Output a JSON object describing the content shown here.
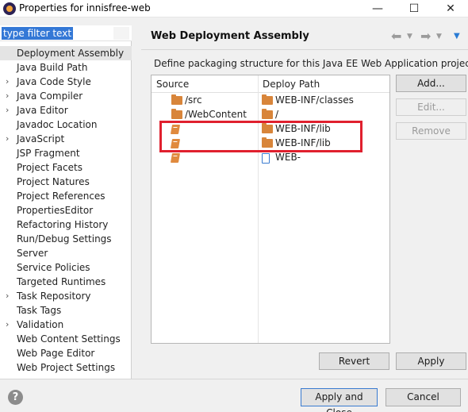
{
  "window": {
    "title": "Properties for innisfree-web",
    "minimize_glyph": "—",
    "maximize_glyph": "☐",
    "close_glyph": "✕"
  },
  "filter": {
    "value": "type filter text"
  },
  "tree": {
    "items": [
      {
        "label": "Deployment Assembly",
        "expandable": false,
        "selected": true
      },
      {
        "label": "Java Build Path",
        "expandable": false
      },
      {
        "label": "Java Code Style",
        "expandable": true
      },
      {
        "label": "Java Compiler",
        "expandable": true
      },
      {
        "label": "Java Editor",
        "expandable": true
      },
      {
        "label": "Javadoc Location",
        "expandable": false
      },
      {
        "label": "JavaScript",
        "expandable": true
      },
      {
        "label": "JSP Fragment",
        "expandable": false
      },
      {
        "label": "Project Facets",
        "expandable": false
      },
      {
        "label": "Project Natures",
        "expandable": false
      },
      {
        "label": "Project References",
        "expandable": false
      },
      {
        "label": "PropertiesEditor",
        "expandable": false
      },
      {
        "label": "Refactoring History",
        "expandable": false
      },
      {
        "label": "Run/Debug Settings",
        "expandable": false
      },
      {
        "label": "Server",
        "expandable": false
      },
      {
        "label": "Service Policies",
        "expandable": false
      },
      {
        "label": "Targeted Runtimes",
        "expandable": false
      },
      {
        "label": "Task Repository",
        "expandable": true
      },
      {
        "label": "Task Tags",
        "expandable": false
      },
      {
        "label": "Validation",
        "expandable": true
      },
      {
        "label": "Web Content Settings",
        "expandable": false
      },
      {
        "label": "Web Page Editor",
        "expandable": false
      },
      {
        "label": "Web Project Settings",
        "expandable": false
      }
    ]
  },
  "page": {
    "title": "Web Deployment Assembly",
    "description": "Define packaging structure for this Java EE Web Application project.",
    "nav_icons": [
      "back-arrow-icon",
      "dropdown-icon",
      "forward-arrow-icon",
      "dropdown-icon",
      "view-menu-icon"
    ]
  },
  "table": {
    "source_header": "Source",
    "deploy_header": "Deploy Path",
    "rows": [
      {
        "source": "/src",
        "source_icon": "folder-icon",
        "deploy": "WEB-INF/classes",
        "deploy_icon": "folder-icon"
      },
      {
        "source": "/WebContent",
        "source_icon": "folder-icon",
        "deploy": "/",
        "deploy_icon": "folder-icon"
      },
      {
        "source": "",
        "source_icon": "jar-icon",
        "deploy": "WEB-INF/lib",
        "deploy_icon": "folder-icon"
      },
      {
        "source": "",
        "source_icon": "jar-icon",
        "deploy": "WEB-INF/lib",
        "deploy_icon": "folder-icon"
      },
      {
        "source": "",
        "source_icon": "jar-icon",
        "deploy": "WEB-",
        "deploy_icon": "file-icon"
      }
    ],
    "highlight_color": "#e0202e"
  },
  "buttons": {
    "add": "Add...",
    "edit": "Edit...",
    "remove": "Remove",
    "revert": "Revert",
    "apply": "Apply",
    "apply_close": "Apply and Close",
    "cancel": "Cancel"
  },
  "help": {
    "glyph": "?"
  },
  "colors": {
    "selection": "#3478d6",
    "folder": "#d8853a",
    "accent": "#2a7bd4"
  }
}
